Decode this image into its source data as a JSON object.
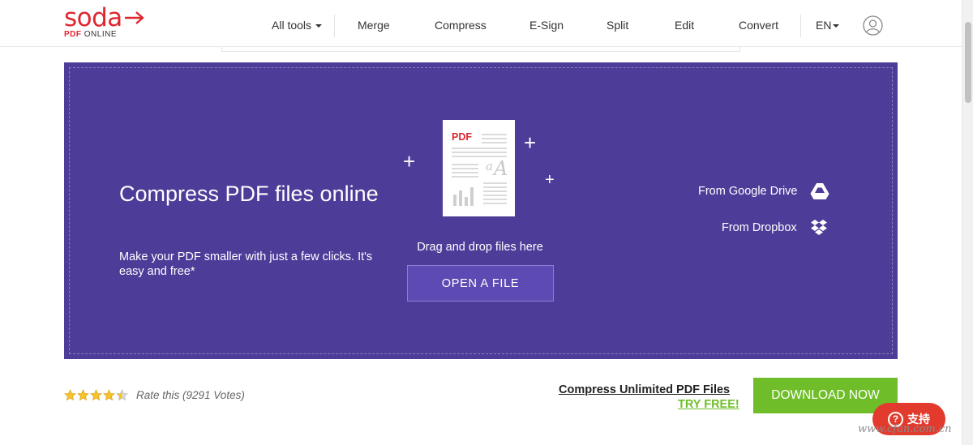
{
  "header": {
    "logo_word": "soda",
    "logo_sub_bold": "PDF",
    "logo_sub_rest": " ONLINE",
    "nav": {
      "all_tools": "All tools",
      "merge": "Merge",
      "compress": "Compress",
      "esign": "E-Sign",
      "split": "Split",
      "edit": "Edit",
      "convert": "Convert",
      "language": "EN"
    },
    "user_icon": "user-circle-icon"
  },
  "hero": {
    "title": "Compress PDF files online",
    "description": "Make your PDF smaller with just a few clicks. It's easy and free*",
    "doc_label": "PDF",
    "doc_italic": "a",
    "doc_big": "A",
    "drag_text": "Drag and drop files here",
    "open_button": "OPEN A FILE",
    "google_drive": "From Google Drive",
    "dropbox": "From Dropbox",
    "bg_color": "#4e3c99"
  },
  "bottom": {
    "stars": 4.5,
    "rate_text": "Rate this (9291 Votes)",
    "unlimited_text": "Compress Unlimited PDF Files",
    "try_free": "TRY FREE!",
    "download_button": "DOWNLOAD NOW",
    "accent_color": "#6fbe29"
  },
  "support_badge": {
    "icon": "?",
    "label": "支持"
  },
  "watermark": "www.cfan.com.cn",
  "brand_color": "#e0262f"
}
